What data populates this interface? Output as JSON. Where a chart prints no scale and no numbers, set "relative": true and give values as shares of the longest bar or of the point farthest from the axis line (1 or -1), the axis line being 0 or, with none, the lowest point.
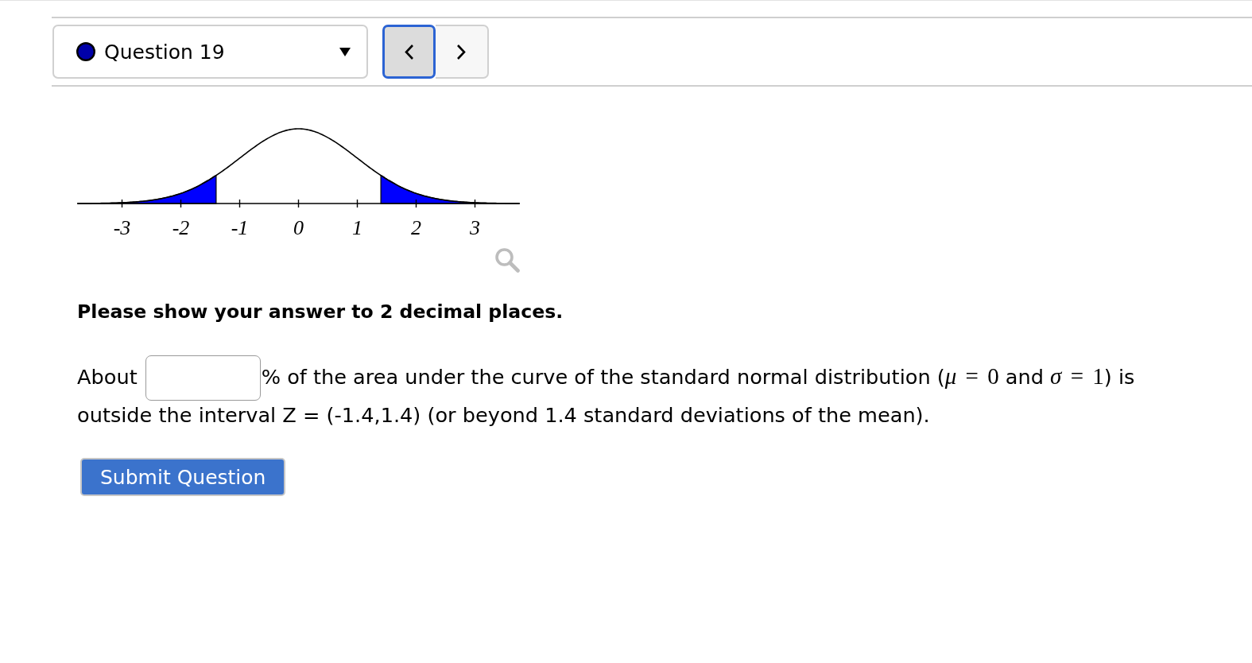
{
  "question_nav": {
    "title": "Question 19",
    "color": "#0000a8",
    "buttons": [
      {
        "kind": "previous",
        "focused": true
      },
      {
        "kind": "next",
        "focused": false
      }
    ]
  },
  "figure": {
    "chart_data": {
      "type": "line",
      "relative": true,
      "xlim": [
        -3.75,
        3.75
      ],
      "xticks": [
        -3,
        -2,
        -1,
        0,
        1,
        2,
        3
      ],
      "series": [
        {
          "color": "#000000",
          "x": [
            -3.75,
            -3.5,
            -3.25,
            -3,
            -2.75,
            -2.5,
            -2.25,
            -2,
            -1.75,
            -1.5,
            -1.25,
            -1,
            -0.75,
            -0.5,
            -0.25,
            0,
            0.25,
            0.5,
            0.75,
            1,
            1.25,
            1.5,
            1.75,
            2,
            2.25,
            2.5,
            2.75,
            3,
            3.25,
            3.5,
            3.75
          ],
          "values": [
            0.001,
            0.002,
            0.005,
            0.011,
            0.023,
            0.044,
            0.08,
            0.135,
            0.216,
            0.325,
            0.458,
            0.607,
            0.755,
            0.882,
            0.969,
            1,
            0.969,
            0.882,
            0.755,
            0.607,
            0.458,
            0.325,
            0.216,
            0.135,
            0.08,
            0.044,
            0.023,
            0.011,
            0.005,
            0.002,
            0.001
          ]
        },
        {
          "type": "area",
          "color": "#0000ff",
          "x": [
            -3.75,
            -3.5,
            -3.25,
            -3,
            -2.75,
            -2.5,
            -2.25,
            -2,
            -1.75,
            -1.5,
            -1.4
          ],
          "values": [
            0.001,
            0.002,
            0.005,
            0.011,
            0.023,
            0.044,
            0.08,
            0.135,
            0.216,
            0.325,
            0.375
          ]
        },
        {
          "type": "area",
          "color": "#0000ff",
          "x": [
            1.4,
            1.5,
            1.75,
            2,
            2.25,
            2.5,
            2.75,
            3,
            3.25,
            3.5,
            3.75
          ],
          "values": [
            0.375,
            0.325,
            0.216,
            0.135,
            0.08,
            0.044,
            0.023,
            0.011,
            0.005,
            0.002,
            0.001
          ]
        }
      ]
    }
  },
  "instruction": "Please show your answer to 2 decimal places.",
  "statement": {
    "lines": [
      [
        {
          "kind": "text",
          "text": "About"
        },
        {
          "kind": "blank"
        },
        {
          "kind": "text",
          "text": "% of the area under the curve of the standard normal distribution ("
        },
        {
          "kind": "math",
          "text": "*μ* = 0"
        },
        {
          "kind": "text",
          "text": " and "
        },
        {
          "kind": "math",
          "text": "*σ* = 1"
        },
        {
          "kind": "text",
          "text": ") is"
        }
      ],
      [
        {
          "kind": "text",
          "text": "outside the interval Z = (-1.4,1.4) (or beyond 1.4 standard deviations of the mean)."
        }
      ]
    ]
  },
  "submit_button": {
    "label": "Submit Question"
  }
}
